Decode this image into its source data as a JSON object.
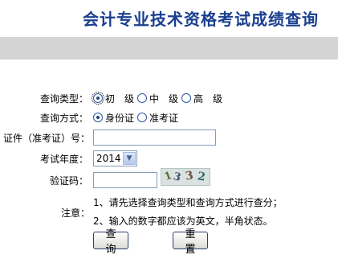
{
  "page_title": "会计专业技术资格考试成绩查询",
  "form": {
    "query_type": {
      "label": "查询类型：",
      "options": [
        "初　级",
        "中　级",
        "高　级"
      ],
      "selected": 0
    },
    "query_method": {
      "label": "查询方式：",
      "options": [
        "身份证",
        "准考证"
      ],
      "selected": 0
    },
    "id_number": {
      "label": "证件（准考证）号：",
      "value": ""
    },
    "exam_year": {
      "label": "考试年度：",
      "value": "2014"
    },
    "captcha": {
      "label": "验证码：",
      "value": "",
      "image_text": "1332"
    },
    "notes": {
      "label": "注意：",
      "lines": [
        "1、请先选择查询类型和查询方式进行查分；",
        "2、输入的数字都应该为英文，半角状态。"
      ]
    }
  },
  "buttons": {
    "query": "查 询",
    "reset": "重 置"
  },
  "colors": {
    "title": "#1a3f8f",
    "bar": "#d4d4d4"
  }
}
